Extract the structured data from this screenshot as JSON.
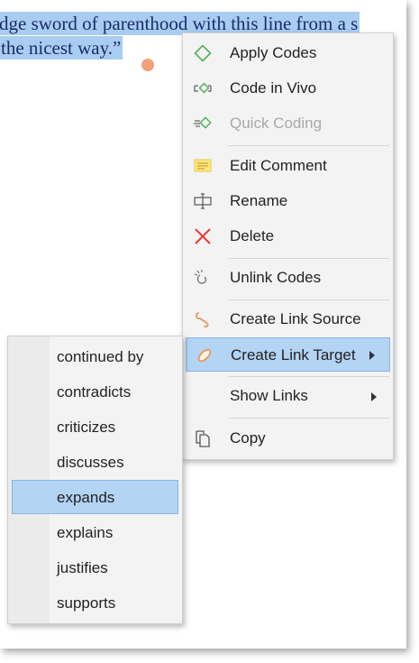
{
  "document": {
    "line1": "dge sword of parenthood with this line from a s",
    "line2": "the nicest way.”"
  },
  "context_menu": {
    "items": [
      {
        "label": "Apply Codes",
        "icon": "apply-codes-icon"
      },
      {
        "label": "Code in Vivo",
        "icon": "code-in-vivo-icon"
      },
      {
        "label": "Quick Coding",
        "icon": "quick-coding-icon",
        "disabled": true
      },
      {
        "label": "Edit Comment",
        "icon": "edit-comment-icon"
      },
      {
        "label": "Rename",
        "icon": "rename-icon"
      },
      {
        "label": "Delete",
        "icon": "delete-icon"
      },
      {
        "label": "Unlink Codes",
        "icon": "unlink-codes-icon"
      },
      {
        "label": "Create Link Source",
        "icon": "link-source-icon"
      },
      {
        "label": "Create Link Target",
        "icon": "link-target-icon",
        "highlighted": true,
        "submenu": true
      },
      {
        "label": "Show Links",
        "icon": "",
        "submenu": true
      },
      {
        "label": "Copy",
        "icon": "copy-icon"
      }
    ]
  },
  "link_target_submenu": {
    "items": [
      {
        "label": "continued by"
      },
      {
        "label": "contradicts"
      },
      {
        "label": "criticizes"
      },
      {
        "label": "discusses"
      },
      {
        "label": "expands",
        "highlighted": true
      },
      {
        "label": "explains"
      },
      {
        "label": "justifies"
      },
      {
        "label": "supports"
      }
    ]
  },
  "colors": {
    "selection": "#a9cdf0",
    "highlight": "#b3d4f3",
    "highlight_border": "#86b6e3",
    "handle": "#f2a07b",
    "green_icon": "#4caf50",
    "delete_red": "#e53935",
    "orange_link": "#e8955a"
  }
}
